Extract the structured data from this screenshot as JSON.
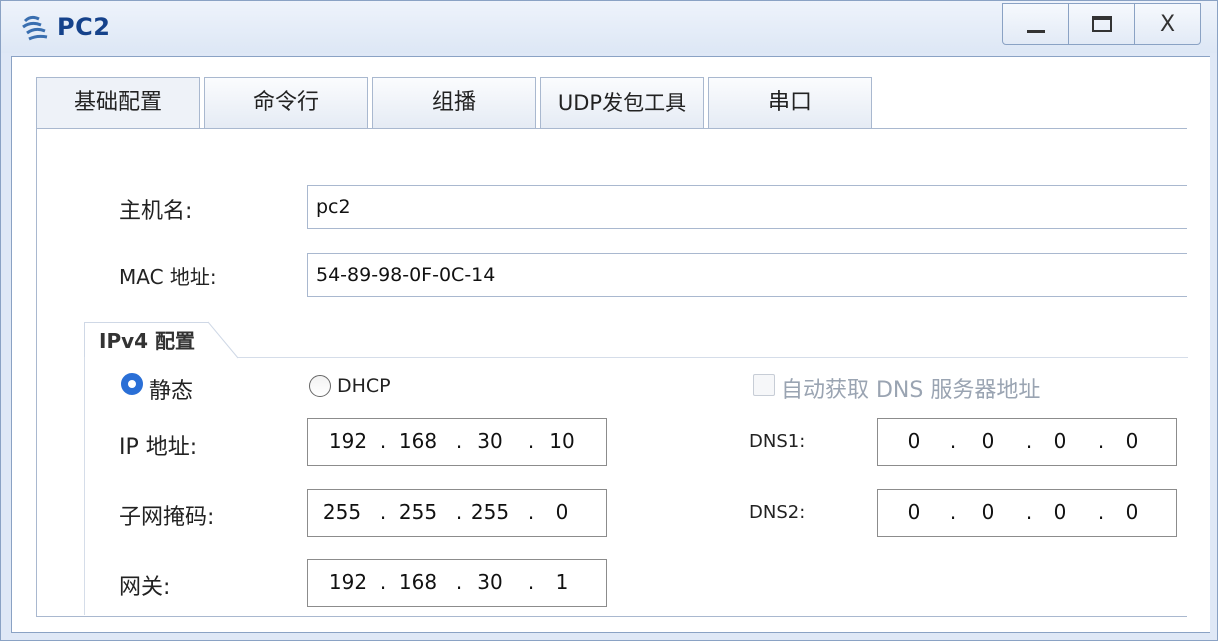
{
  "window": {
    "title": "PC2",
    "icon": "pc-icon"
  },
  "controls": {
    "minimize": "_",
    "maximize": "□",
    "close": "X"
  },
  "tabs": [
    {
      "label": "基础配置",
      "active": true
    },
    {
      "label": "命令行",
      "active": false
    },
    {
      "label": "组播",
      "active": false
    },
    {
      "label": "UDP发包工具",
      "active": false
    },
    {
      "label": "串口",
      "active": false
    }
  ],
  "basic": {
    "hostname_label": "主机名:",
    "hostname_value": "pc2",
    "mac_label": "MAC 地址:",
    "mac_value": "54-89-98-0F-0C-14"
  },
  "ipv4": {
    "group_label": "IPv4 配置",
    "static_label": "静态",
    "dhcp_label": "DHCP",
    "auto_dns_label": "自动获取 DNS 服务器地址",
    "ip_label": "IP 地址:",
    "ip": [
      "192",
      "168",
      "30",
      "10"
    ],
    "mask_label": "子网掩码:",
    "mask": [
      "255",
      "255",
      "255",
      "0"
    ],
    "gateway_label": "网关:",
    "gateway": [
      "192",
      "168",
      "30",
      "1"
    ],
    "dns1_label": "DNS1:",
    "dns1": [
      "0",
      "0",
      "0",
      "0"
    ],
    "dns2_label": "DNS2:",
    "dns2": [
      "0",
      "0",
      "0",
      "0"
    ],
    "mode": "static",
    "auto_dns": false
  },
  "colors": {
    "title": "#15428b",
    "accent": "#2a6fd6",
    "border": "#8aa2c4"
  }
}
